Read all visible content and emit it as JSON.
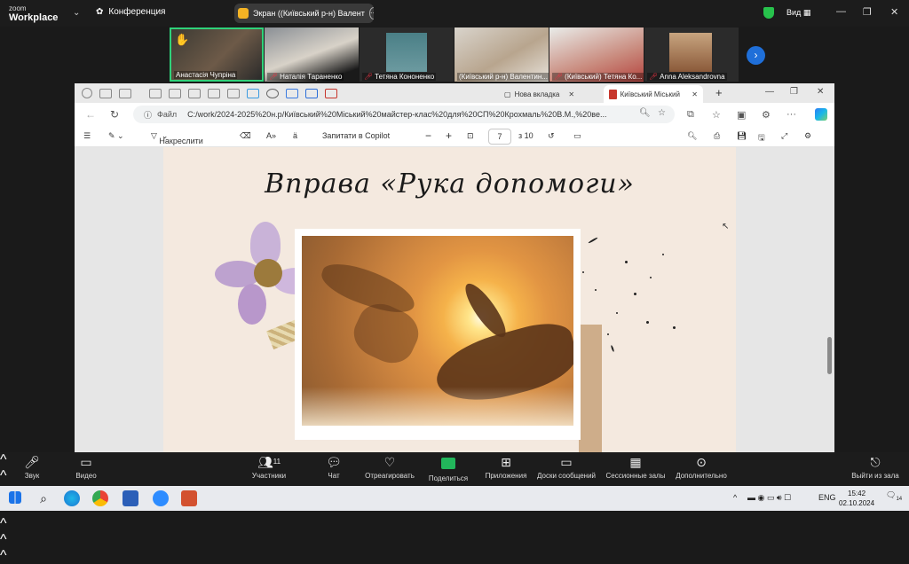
{
  "zoom_top": {
    "logo_line1": "zoom",
    "logo_line2": "Workplace",
    "conference_label": "Конференция",
    "share_label": "Экран ((Київський р-н) Валент",
    "view_label": "Вид",
    "minimize": "—",
    "restore": "❐",
    "close": "✕"
  },
  "participants": [
    {
      "name": "Анастасія Чупріна",
      "active": true,
      "muted": false
    },
    {
      "name": "Наталія Тараненко",
      "active": false,
      "muted": true
    },
    {
      "name": "Тетяна Кононенко",
      "active": false,
      "muted": true
    },
    {
      "name": "(Київський р-н) Валентин...",
      "active": false,
      "muted": false
    },
    {
      "name": "(Київський) Тетяна Ко...",
      "active": false,
      "muted": true
    },
    {
      "name": "Anna Aleksandrovna",
      "active": false,
      "muted": true
    }
  ],
  "browser": {
    "tab_new": "Нова вкладка",
    "tab_active": "Київський Міський",
    "file_label": "Файл",
    "url": "C:/work/2024-2025%20н.р/Київський%20Міський%20майстер-клас%20для%20СП%20Крохмаль%20В.М.,%20ве..."
  },
  "pdf_toolbar": {
    "draw": "Накреслити",
    "ask_copilot": "Запитати в Copilot",
    "minus": "−",
    "plus": "+",
    "page": "7",
    "of_pages": "з 10"
  },
  "slide": {
    "title": "Вправа «Рука допомоги»"
  },
  "zoom_bottom": {
    "audio": "Звук",
    "video": "Видео",
    "participants": "Участники",
    "participants_count": "11",
    "chat": "Чат",
    "react": "Отреагировать",
    "share": "Поделиться",
    "apps": "Приложения",
    "whiteboards": "Доски сообщений",
    "breakout": "Сессионные залы",
    "more": "Дополнительно",
    "leave": "Выйти из зала"
  },
  "taskbar": {
    "lang": "ENG",
    "time": "15:42",
    "date": "02.10.2024",
    "notif_count": "14"
  },
  "colors": {
    "active_speaker_border": "#2fd27a",
    "share_green": "#22b65b",
    "slide_bg": "#f4e9df"
  }
}
